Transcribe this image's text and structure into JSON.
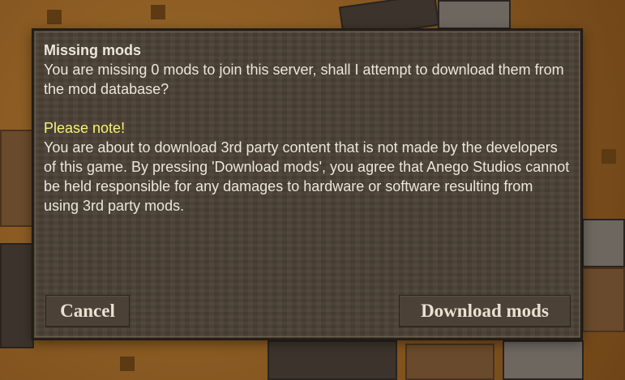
{
  "dialog": {
    "title": "Missing mods",
    "message": "You are missing 0 mods to join this server, shall I attempt to download them from the mod database?",
    "note_heading": "Please note!",
    "note_body": "You are about to download 3rd party content that is not made by the developers of this game. By pressing 'Download mods', you agree that Anego Studios cannot be held responsible for any damages to hardware or software resulting from using 3rd party mods.",
    "cancel_label": "Cancel",
    "download_label": "Download mods"
  },
  "colors": {
    "background": "#8a5a22",
    "panel": "#4a4035",
    "text": "#ece6dc",
    "note_text": "#f7f27a"
  }
}
